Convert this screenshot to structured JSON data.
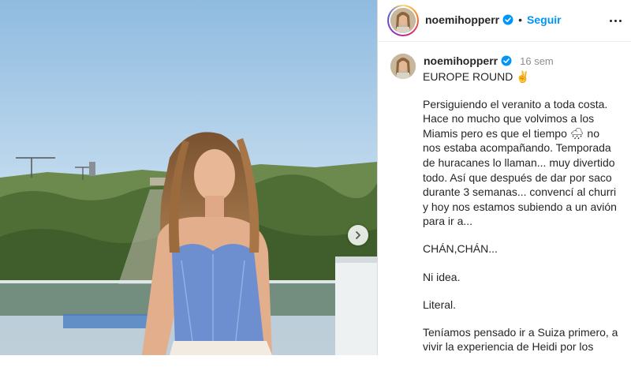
{
  "post": {
    "username": "noemihopperr",
    "follow_label": "Seguir",
    "separator": "•",
    "time_ago": "16 sem",
    "caption": [
      "EUROPE ROUND ✌️",
      "Persiguiendo el veranito a toda costa. Hace no mucho que volvimos a los Miamis pero es que el tiempo 🌧 no nos estaba acompañando. Temporada de huracanes lo llaman... muy divertido todo. Así que después de dar por saco durante 3 semanas... convencí al churri y hoy nos estamos subiendo a un avión para ir a...",
      "CHÁN,CHÁN...",
      "Ni idea.",
      "Literal.",
      "Teníamos pensado ir a Suiza primero, a vivir la experiencia de Heidi por los"
    ]
  },
  "icons": {
    "verified": "verified-badge-icon",
    "next": "chevron-right-icon",
    "more": "more-options-icon"
  },
  "colors": {
    "link": "#0095f6",
    "verified": "#0095f6",
    "text": "#262626",
    "muted": "#8e8e8e"
  }
}
